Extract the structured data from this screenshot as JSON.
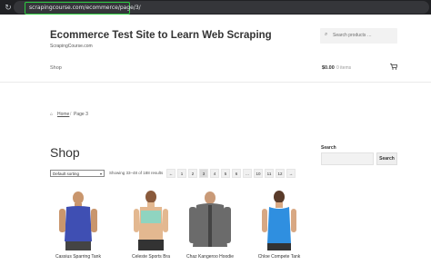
{
  "browser": {
    "url": "scrapingcourse.com/ecommerce/page/3/",
    "reload_icon": "reload-icon"
  },
  "header": {
    "site_title": "Ecommerce Test Site to Learn Web Scraping",
    "site_description": "ScrapingCourse.com",
    "search_placeholder": "Search products …",
    "nav_shop": "Shop",
    "cart_total": "$0.00",
    "cart_items": "0 items"
  },
  "breadcrumb": {
    "home": "Home",
    "separator": "/",
    "current": "Page 3"
  },
  "main": {
    "heading": "Shop",
    "sorting": "Default sorting",
    "results": "Showing 33–48 of 188 results",
    "pagination": [
      "←",
      "1",
      "2",
      "3",
      "4",
      "5",
      "6",
      "…",
      "10",
      "11",
      "12",
      "→"
    ],
    "current_page": "3"
  },
  "sidebar": {
    "search_label": "Search",
    "search_button": "Search"
  },
  "products": [
    {
      "name": "Cassius Sparring Tank",
      "shirt_color": "#3f4fb3"
    },
    {
      "name": "Celeste Sports Bra",
      "shirt_color": "#8fd4c0"
    },
    {
      "name": "Chaz Kangeroo Hoodie",
      "shirt_color": "#6b6b6b"
    },
    {
      "name": "Chloe Compete Tank",
      "shirt_color": "#2f8fe0"
    }
  ],
  "colors": {
    "url_highlight": "#2ecc40",
    "chrome_bg": "#202124"
  }
}
